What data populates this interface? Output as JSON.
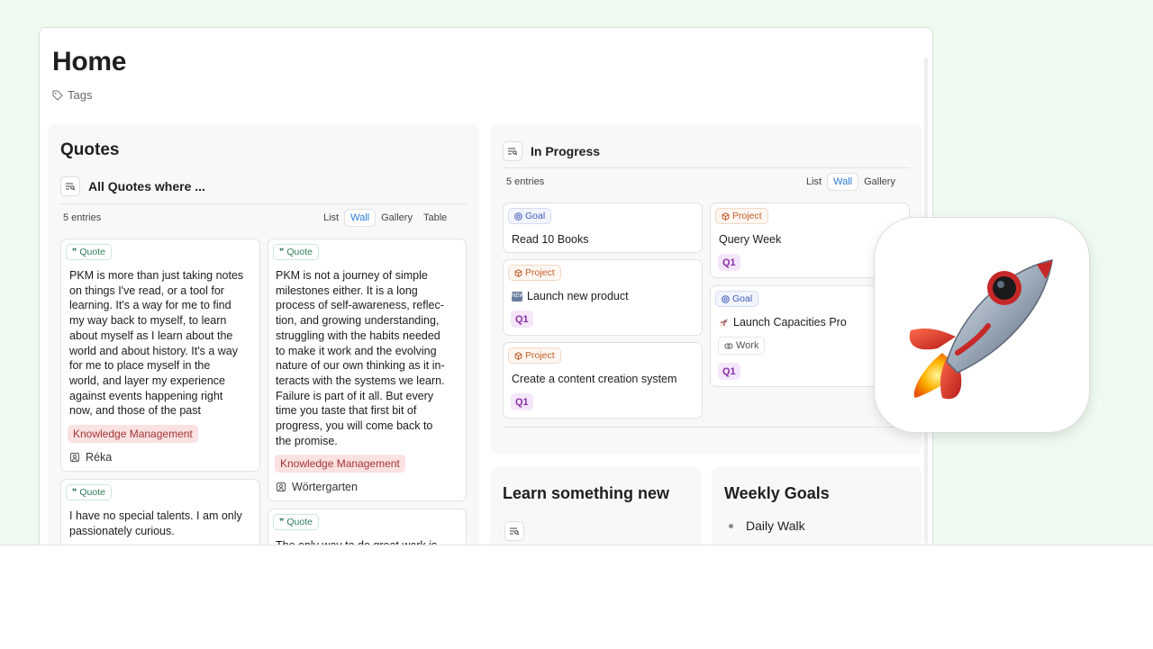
{
  "page": {
    "title": "Home",
    "tags_label": "Tags"
  },
  "quotes": {
    "heading": "Quotes",
    "query_title": "All Quotes where ...",
    "entries": "5 entries",
    "views": [
      "List",
      "Wall",
      "Gallery",
      "Table"
    ],
    "active_view": "Wall",
    "cards": [
      {
        "type": "Quote",
        "text": [
          "PKM is more than just taking notes",
          "on things I've read, or a tool for",
          "learning. It's a way for me to find",
          "my way back to myself, to learn",
          "about myself as I learn about the",
          "world and about history. It's a way",
          "for me to place myself in the",
          "world, and layer my experience",
          "against events happening right",
          "now, and those of the past"
        ],
        "tag": "Knowledge Management",
        "author": "Réka"
      },
      {
        "type": "Quote",
        "text": [
          "PKM is not a journey of simple",
          "milestones either. It is a long",
          "process of self-awareness, reflec-",
          "tion, and growing understanding,",
          "struggling with the habits needed",
          "to make it work and the evolving",
          "nature of our own thinking as it in-",
          "teracts with the systems we learn.",
          "Failure is part of it all. But every",
          "time you taste that first bit of",
          "progress, you will come back to",
          "the promise."
        ],
        "tag": "Knowledge Management",
        "author": "Wörtergarten"
      },
      {
        "type": "Quote",
        "text": [
          "I have no special talents. I am only",
          "passionately curious."
        ]
      },
      {
        "type": "Quote",
        "text": [
          "The only way to do great work is"
        ]
      }
    ]
  },
  "in_progress": {
    "heading": "In Progress",
    "entries": "5 entries",
    "views": [
      "List",
      "Wall",
      "Gallery"
    ],
    "active_view": "Wall",
    "cards": [
      {
        "type": "Goal",
        "title": "Read 10 Books"
      },
      {
        "type": "Project",
        "title": "Query Week",
        "quarter": "Q1"
      },
      {
        "type": "Project",
        "title": "Launch new product",
        "quarter": "Q1"
      },
      {
        "type": "Goal",
        "title": "Launch Capacities Pro",
        "tag": "Work",
        "quarter": "Q1"
      },
      {
        "type": "Project",
        "title": "Create a content creation system",
        "quarter": "Q1"
      }
    ]
  },
  "learn": {
    "heading": "Learn something new"
  },
  "weekly": {
    "heading": "Weekly Goals",
    "items": [
      "Daily Walk"
    ]
  },
  "colors": {
    "background": "#eefaf0",
    "accent": "#2a7bd8",
    "tag_red": "#fbe1e1",
    "q1_purple": "#f5e6fb"
  },
  "icons": [
    "tag-icon",
    "query-icon",
    "quote-icon",
    "goal-icon",
    "project-icon",
    "person-icon",
    "work-icon",
    "rocket-icon"
  ]
}
